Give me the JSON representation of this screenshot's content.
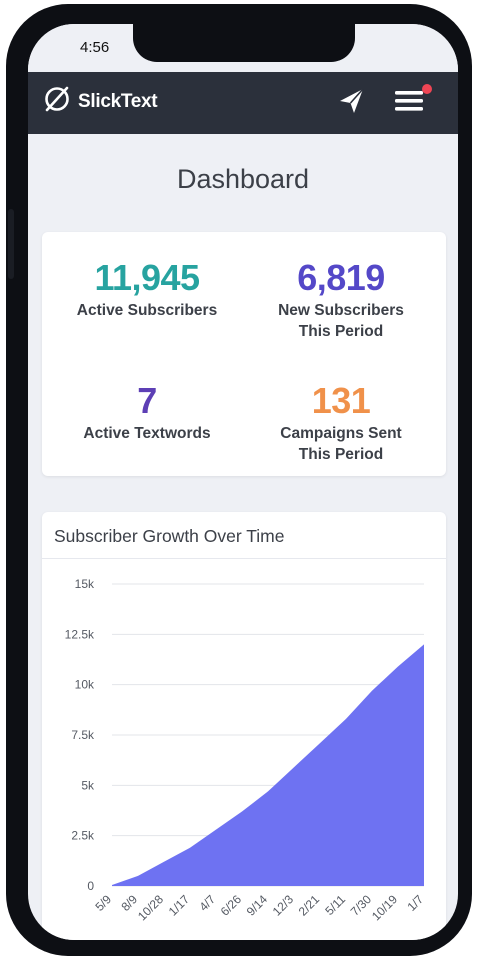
{
  "status_bar": {
    "time": "4:56"
  },
  "navbar": {
    "brand": "SlickText"
  },
  "page": {
    "title": "Dashboard"
  },
  "stats": [
    {
      "value": "11,945",
      "label_line1": "Active Subscribers",
      "label_line2": "",
      "color": "#27a3a0"
    },
    {
      "value": "6,819",
      "label_line1": "New Subscribers",
      "label_line2": "This Period",
      "color": "#5448c8"
    },
    {
      "value": "7",
      "label_line1": "Active Textwords",
      "label_line2": "",
      "color": "#5d3fb5"
    },
    {
      "value": "131",
      "label_line1": "Campaigns Sent",
      "label_line2": "This Period",
      "color": "#f0914a"
    }
  ],
  "chart": {
    "title": "Subscriber Growth Over Time"
  },
  "chart_data": {
    "type": "area",
    "title": "Subscriber Growth Over Time",
    "fill_color": "#6e72f2",
    "y_ticks": [
      "0",
      "2.5k",
      "5k",
      "7.5k",
      "10k",
      "12.5k",
      "15k"
    ],
    "ylim": [
      0,
      15000
    ],
    "x_ticks": [
      "5/9",
      "8/9",
      "10/28",
      "1/17",
      "4/7",
      "6/26",
      "9/14",
      "12/3",
      "2/21",
      "5/11",
      "7/30",
      "10/19",
      "1/7"
    ],
    "values": [
      50,
      500,
      1200,
      1900,
      2800,
      3700,
      4700,
      5900,
      7100,
      8300,
      9700,
      10900,
      12000
    ],
    "grid": true
  }
}
